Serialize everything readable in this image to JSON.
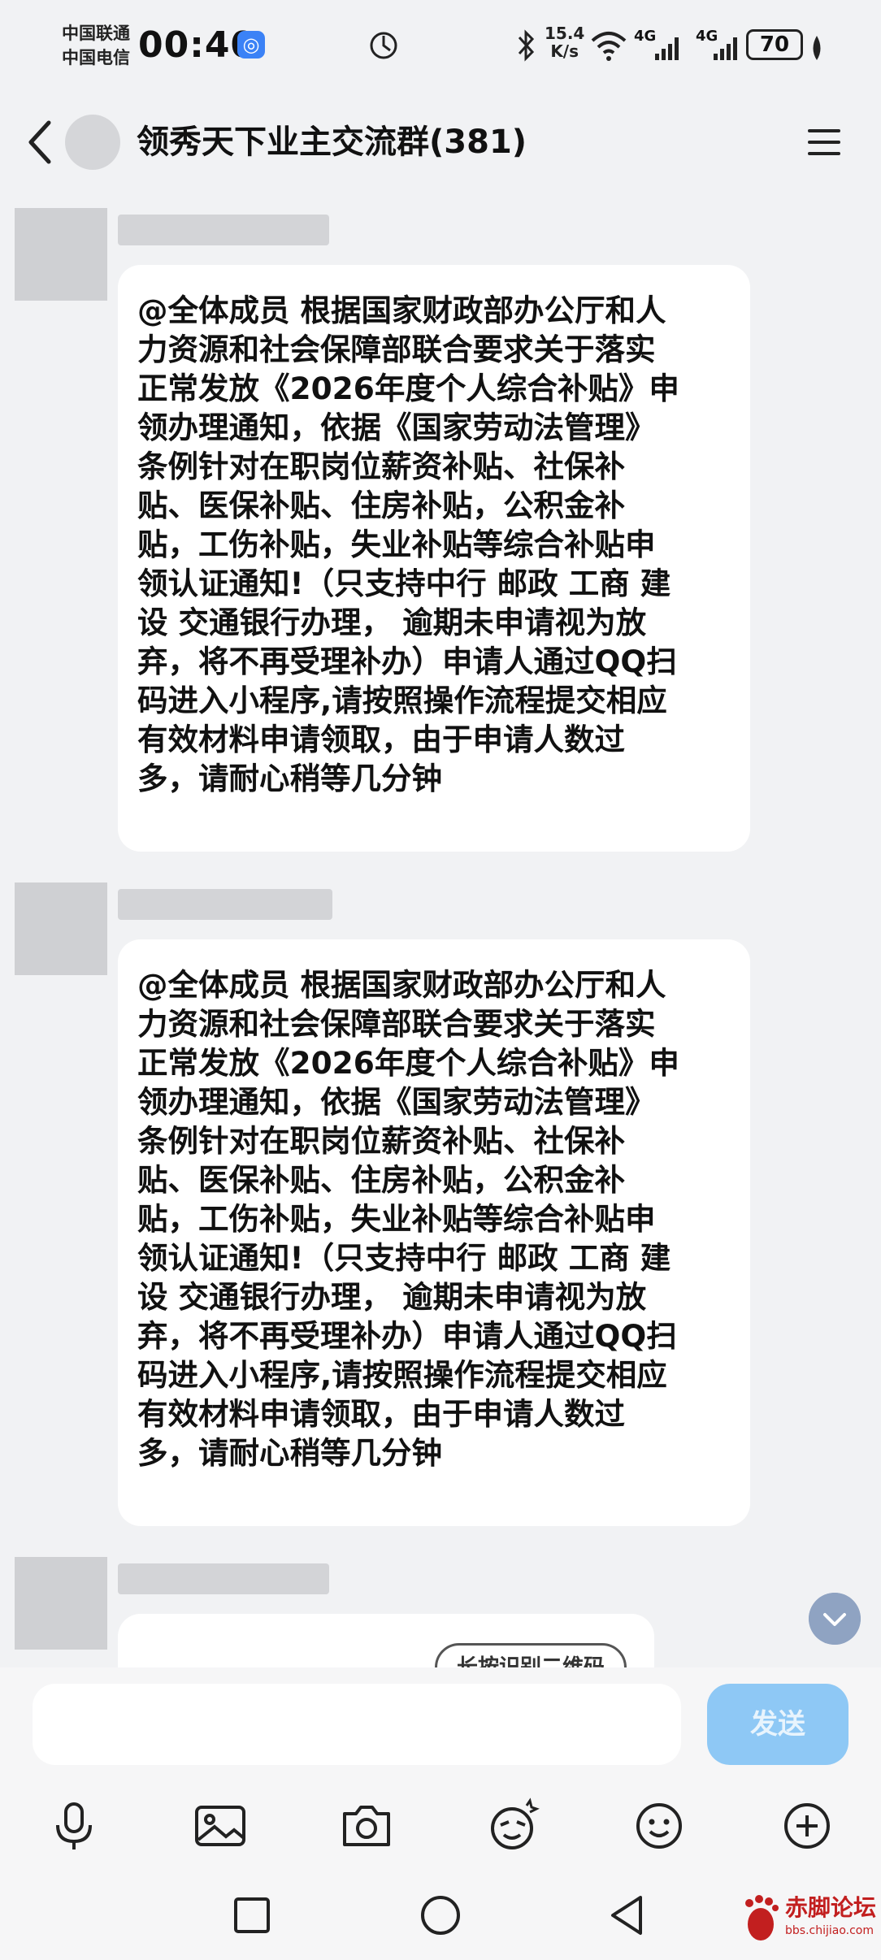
{
  "status": {
    "carrier1": "中国联通",
    "carrier2": "中国电信",
    "time": "00:40",
    "net_speed_value": "15.4",
    "net_speed_unit": "K/s",
    "signal1": "4G",
    "signal2": "4G",
    "battery": "70"
  },
  "header": {
    "title": "领秀天下业主交流群(381)"
  },
  "messages": [
    {
      "text": "@全体成员 根据国家财政部办公厅和人\n力资源和社会保障部联合要求关于落实\n正常发放《2026年度个人综合补贴》申\n领办理通知，依据《国家劳动法管理》\n条例针对在职岗位薪资补贴、社保补\n贴、医保补贴、住房补贴，公积金补\n贴，工伤补贴，失业补贴等综合补贴申\n领认证通知!（只支持中行 邮政 工商 建\n设 交通银行办理，   逾期未申请视为放\n弃，将不再受理补办）申请人通过QQ扫\n码进入小程序,请按照操作流程提交相应\n有效材料申请领取，由于申请人数过\n多，请耐心稍等几分钟"
    },
    {
      "text": "@全体成员 根据国家财政部办公厅和人\n力资源和社会保障部联合要求关于落实\n正常发放《2026年度个人综合补贴》申\n领办理通知，依据《国家劳动法管理》\n条例针对在职岗位薪资补贴、社保补\n贴、医保补贴、住房补贴，公积金补\n贴，工伤补贴，失业补贴等综合补贴申\n领认证通知!（只支持中行 邮政 工商 建\n设 交通银行办理，   逾期未申请视为放\n弃，将不再受理补办）申请人通过QQ扫\n码进入小程序,请按照操作流程提交相应\n有效材料申请领取，由于申请人数过\n多，请耐心稍等几分钟"
    },
    {
      "button": "长按识别二维码"
    }
  ],
  "input": {
    "placeholder": "",
    "send_label": "发送"
  },
  "watermark": {
    "name": "赤脚论坛",
    "url": "bbs.chijiao.com"
  }
}
